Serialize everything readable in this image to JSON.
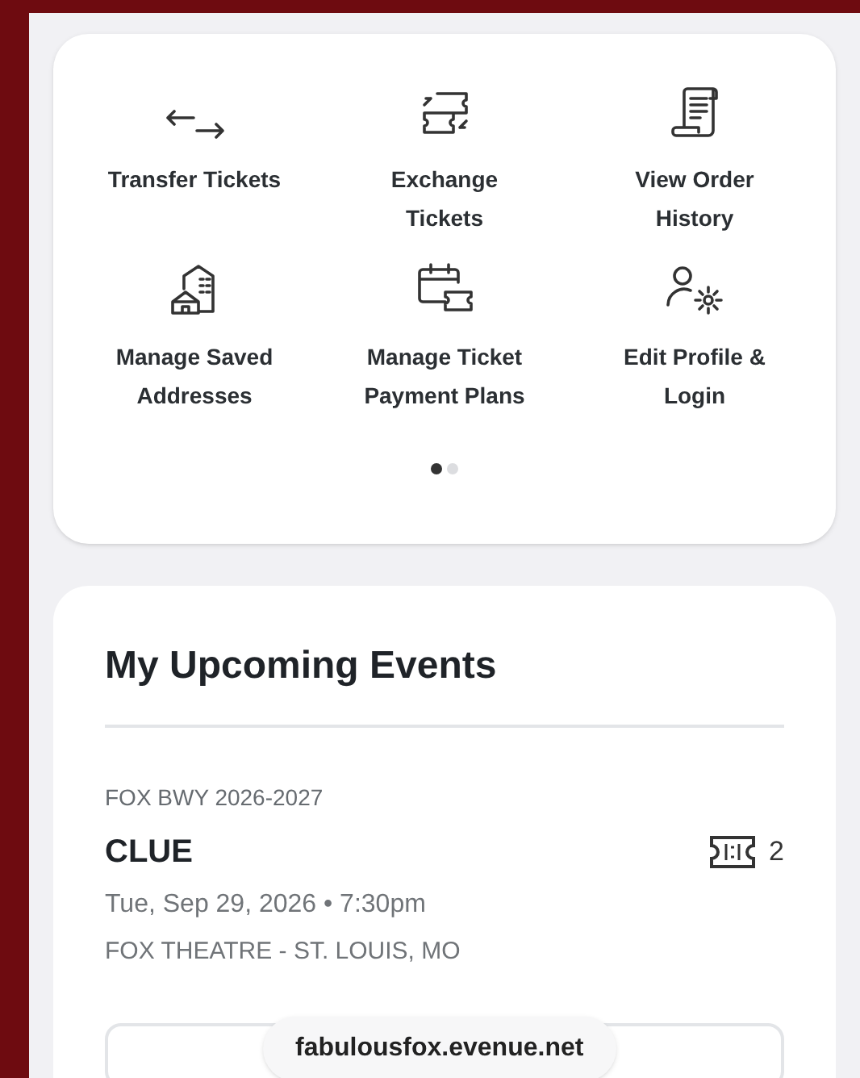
{
  "actions": [
    {
      "kind": "transfer",
      "label": "Transfer Tickets"
    },
    {
      "kind": "exchange",
      "label": "Exchange Tickets"
    },
    {
      "kind": "history",
      "label": "View Order History"
    },
    {
      "kind": "addresses",
      "label": "Manage Saved Addresses"
    },
    {
      "kind": "plans",
      "label": "Manage Ticket Payment Plans"
    },
    {
      "kind": "profile",
      "label": "Edit Profile & Login"
    }
  ],
  "pager": [
    {
      "selected": true
    },
    {
      "selected": false
    }
  ],
  "events": {
    "title": "My Upcoming Events",
    "items": [
      {
        "series": "FOX BWY 2026-2027",
        "name": "CLUE",
        "ticket_count": "2",
        "date": "Tue, Sep 29, 2026 • 7:30pm",
        "venue": "FOX THEATRE - ST. LOUIS, MO"
      }
    ]
  },
  "url_pill": "fabulousfox.evenue.net"
}
